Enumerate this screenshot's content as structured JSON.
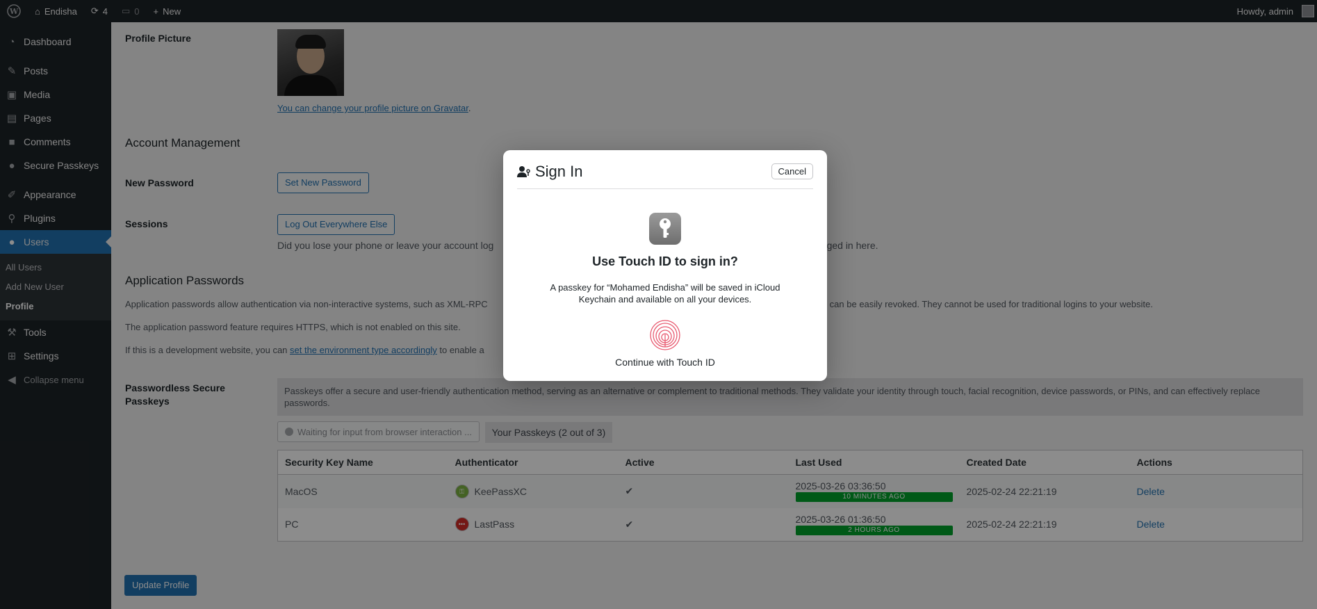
{
  "adminbar": {
    "site_name": "Endisha",
    "updates_count": "4",
    "comments_count": "0",
    "new_label": "New",
    "howdy": "Howdy, admin"
  },
  "sidebar": {
    "items": [
      {
        "label": "Dashboard",
        "icon": "dashboard-icon"
      },
      {
        "label": "Posts",
        "icon": "pin-icon"
      },
      {
        "label": "Media",
        "icon": "media-icon"
      },
      {
        "label": "Pages",
        "icon": "pages-icon"
      },
      {
        "label": "Comments",
        "icon": "comments-icon"
      },
      {
        "label": "Secure Passkeys",
        "icon": "users-icon"
      },
      {
        "label": "Appearance",
        "icon": "brush-icon"
      },
      {
        "label": "Plugins",
        "icon": "plug-icon"
      },
      {
        "label": "Users",
        "icon": "user-icon"
      },
      {
        "label": "Tools",
        "icon": "wrench-icon"
      },
      {
        "label": "Settings",
        "icon": "settings-icon"
      }
    ],
    "submenu": [
      "All Users",
      "Add New User",
      "Profile"
    ],
    "collapse_label": "Collapse menu"
  },
  "profile": {
    "picture_label": "Profile Picture",
    "gravatar_link": "You can change your profile picture on Gravatar",
    "gravatar_suffix": "."
  },
  "account": {
    "heading": "Account Management",
    "new_password_label": "New Password",
    "set_password_button": "Set New Password",
    "sessions_label": "Sessions",
    "logout_button": "Log Out Everywhere Else",
    "sessions_desc_left": "Did you lose your phone or leave your account log",
    "sessions_desc_right": "ogged in here."
  },
  "app_passwords": {
    "heading": "Application Passwords",
    "desc1_left": "Application passwords allow authentication via non-interactive systems, such as XML-RPC",
    "desc1_right": "rds can be easily revoked. They cannot be used for traditional logins to your website.",
    "desc2": "The application password feature requires HTTPS, which is not enabled on this site.",
    "desc3_prefix": "If this is a development website, you can ",
    "desc3_link": "set the environment type accordingly",
    "desc3_suffix": " to enable a"
  },
  "passkeys": {
    "label": "Passwordless Secure Passkeys",
    "notice": "Passkeys offer a secure and user-friendly authentication method, serving as an alternative or complement to traditional methods. They validate your identity through touch, facial recognition, device passwords, or PINs, and can effectively replace passwords.",
    "waiting": "Waiting for input from browser interaction ...",
    "tab_label": "Your Passkeys (2 out of 3)",
    "columns": [
      "Security Key Name",
      "Authenticator",
      "Active",
      "Last Used",
      "Created Date",
      "Actions"
    ],
    "rows": [
      {
        "name": "MacOS",
        "authenticator": "KeePassXC",
        "active": "✔",
        "last_used": "2025-03-26 03:36:50",
        "ago": "10 MINUTES AGO",
        "created": "2025-02-24 22:21:19",
        "action": "Delete",
        "auth_color": "#7cb342"
      },
      {
        "name": "PC",
        "authenticator": "LastPass",
        "active": "✔",
        "last_used": "2025-03-26 01:36:50",
        "ago": "2 HOURS AGO",
        "created": "2025-02-24 22:21:19",
        "action": "Delete",
        "auth_color": "#d32d27"
      }
    ]
  },
  "update_button": "Update Profile",
  "dialog": {
    "title": "Sign In",
    "cancel": "Cancel",
    "heading": "Use Touch ID to sign in?",
    "message": "A passkey for “Mohamed Endisha” will be saved in iCloud Keychain and available on all your devices.",
    "continue": "Continue with Touch ID"
  }
}
